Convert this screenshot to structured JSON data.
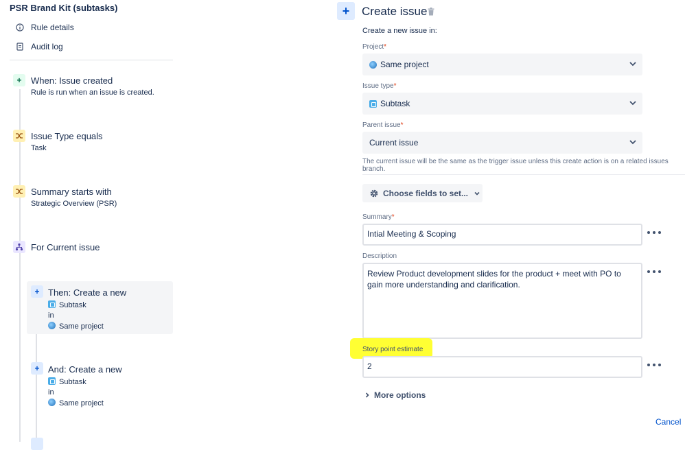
{
  "rule": {
    "title": "PSR Brand Kit (subtasks)",
    "links": [
      {
        "label": "Rule details",
        "icon": "info-icon"
      },
      {
        "label": "Audit log",
        "icon": "log-icon"
      }
    ]
  },
  "flow": {
    "trigger": {
      "title": "When: Issue created",
      "subtitle": "Rule is run when an issue is created."
    },
    "condition1": {
      "title": "Issue Type equals",
      "subtitle": "Task"
    },
    "condition2": {
      "title": "Summary starts with",
      "subtitle": "Strategic Overview (PSR)"
    },
    "branch": {
      "title": "For Current issue"
    },
    "action1": {
      "title": "Then: Create a new",
      "type": "Subtask",
      "in": "in",
      "project": "Same project"
    },
    "action2": {
      "title": "And: Create a new",
      "type": "Subtask",
      "in": "in",
      "project": "Same project"
    }
  },
  "panel": {
    "plus": "+",
    "title": "Create issue",
    "intro": "Create a new issue in:",
    "project": {
      "label": "Project",
      "required": "*",
      "value": "Same project"
    },
    "issue_type": {
      "label": "Issue type",
      "required": "*",
      "value": "Subtask"
    },
    "parent_issue": {
      "label": "Parent issue",
      "required": "*",
      "value": "Current issue"
    },
    "helper": "The current issue will be the same as the trigger issue unless this create action is on a related issues branch.",
    "choose_fields": "Choose fields to set...",
    "summary": {
      "label": "Summary",
      "required": "*",
      "value": "Intial Meeting & Scoping"
    },
    "description": {
      "label": "Description",
      "value": "Review Product development slides for the product + meet with PO to gain more understanding and clarification."
    },
    "story_points": {
      "label": "Story point estimate",
      "value": "2"
    },
    "more_options": "More options",
    "cancel": "Cancel"
  },
  "colors": {
    "accent": "#0052cc",
    "highlight": "#ffff33",
    "required": "#de350b"
  }
}
